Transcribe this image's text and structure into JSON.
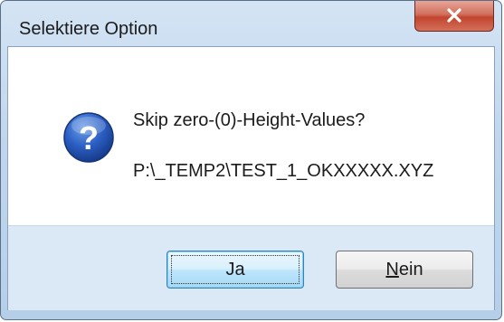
{
  "window": {
    "title": "Selektiere Option"
  },
  "message": {
    "question": "Skip zero-(0)-Height-Values?",
    "path": "P:\\_TEMP2\\TEST_1_OKXXXXX.XYZ",
    "icon": "question-icon"
  },
  "buttons": {
    "yes_label": "Ja",
    "no_label": "Nein"
  },
  "colors": {
    "close_button": "#c2442e",
    "frame": "#b6cfe9",
    "button_area": "#dbe8f6"
  }
}
